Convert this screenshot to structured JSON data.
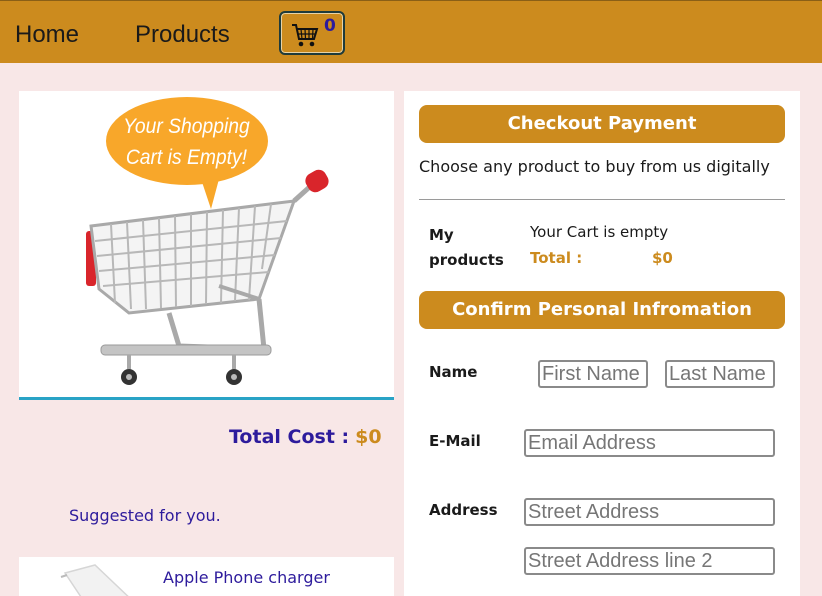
{
  "nav": {
    "home_label": "Home",
    "products_label": "Products",
    "cart_count": "0"
  },
  "cart_illustration": {
    "bubble_line1": "Your Shopping",
    "bubble_line2": "Cart is Empty!"
  },
  "summary": {
    "total_cost_label": "Total Cost :",
    "total_cost_value": "$0",
    "suggested_label": "Suggested for you.",
    "suggested_product": "Apple Phone charger"
  },
  "checkout": {
    "header": "Checkout Payment",
    "description": "Choose any product to buy from us digitally",
    "my_products_label": "My products",
    "cart_status": "Your Cart is empty",
    "total_label": "Total :",
    "total_value": "$0"
  },
  "personal": {
    "header": "Confirm Personal Infromation",
    "name_label": "Name",
    "first_name_placeholder": "First Name",
    "last_name_placeholder": "Last Name",
    "email_label": "E-Mail",
    "email_placeholder": "Email Address",
    "address_label": "Address",
    "street_placeholder": "Street Address",
    "street2_placeholder": "Street Address line 2"
  },
  "colors": {
    "accent": "#cc8b1e",
    "background": "#f8e7e7",
    "heading_text": "#2d1b9c",
    "divider_blue": "#29a3c6"
  }
}
